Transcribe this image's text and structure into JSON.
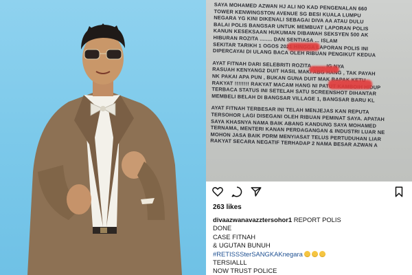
{
  "document": {
    "lines": [
      "SAYA MOHAMED AZWAN HJ ALI NO KAD PENGENALAN 660",
      "TOWER KENWINGSTON AVENUE SG BESI KUALA LUMPU",
      "NEGARA YG KINI DIKENALI SEBAGAI DIVA AA ATAU DULU",
      "BALAI POLIS BANGSAR UNTUK MEMBUAT LAPORAN POLIS",
      "KANUN KESEKSAAN HUKUMAN DIBAWAH SEKSYEN 500 AK",
      "HIBURAN ROZITA ........ DAN SENTIASA ... ISLAM",
      "SEKITAR TARIKH 1 OGOS 2021 HINGGA LAPORAN POLIS INI",
      "DIPERCAYAI DI ULANG BACA OLEH RIBUAN PENGIKUT KEDUA"
    ],
    "lines2": [
      "AYAT FITNAH DARI SELEBRITI ROZITA ........ IG NYA",
      "RASUAH KENYANG2 DUIT HASIL MAKI ABG HANG , TAK PAYAH",
      "NK PAKAI APA PUN , BUKAN GUNA DUIT MAK BAPAK KETU",
      "RAKYAT !!!!!!!! RAKYAT MACAM HANG NI PATUT KAMBOIH HIDUP",
      "TERBACA STATUS INI SETELAH SATU SCREENSHOT DIHANTAR",
      "MEMBELI BELAH DI BANGSAR VILLAGE 1, BANGSAR BARU KL"
    ],
    "lines3": [
      "AYAT FITNAH TERBESAR INI TELAH MENJEJAS KAN REPUTA",
      "TERSOHOR LAGI DISEGANI OLEH RIBUAN PEMINAT SAYA. APATAH",
      "SAYA KHASNYA NAMA BAIK ABANG KANDUNG SAYA MOHAMED",
      "TERNAMA, MENTERI KANAN PERDAGANGAN & INDUSTRI LUAR NE",
      "MOHON JASA BAIK PDRM MENYIASAT TELUS PERTUDUHAN LIAR",
      "RAKYAT SECARA NEGATIF TERHADAP 2 NAMA BESAR AZWAN A"
    ]
  },
  "icons": [
    "heart-icon",
    "comment-icon",
    "share-icon",
    "bookmark-icon"
  ],
  "post": {
    "likes": "263 likes",
    "username": "divaazwanavazztersohor1",
    "caption_first": " REPORT POLIS",
    "caption_lines": [
      "DONE",
      "CASE FITNAH",
      "& UGUTAN BUNUH"
    ],
    "hashtag": "#RETISSSterSANGKAKnegara",
    "after_lines": [
      "TERSIALLL",
      "NOW TRUST POLICE"
    ]
  },
  "colors": {
    "background_sky": "#7cc9ea",
    "hashtag": "#1d4f91",
    "suit": "#8d7154",
    "redaction": "#e23a3a"
  }
}
